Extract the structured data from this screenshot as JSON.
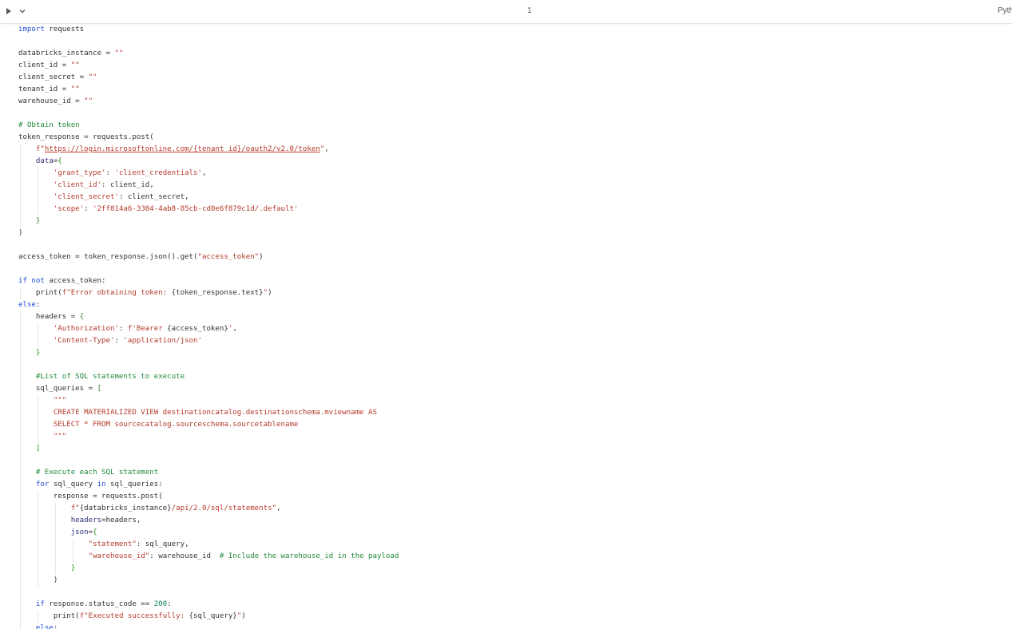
{
  "toolbar": {
    "run_icon": "play-icon",
    "collapse_icon": "chevron-down-icon",
    "cell_number": "1",
    "language": "Python"
  },
  "colors": {
    "keyword": "#1f4bd1",
    "string": "#b4392b",
    "comment": "#218a3a",
    "number": "#0f7d60",
    "kwarg": "#2b2f7a",
    "bracket": "#2f8a28",
    "text": "#333333"
  },
  "code_lines": [
    {
      "indent": 0,
      "tokens": [
        [
          "kw",
          "import"
        ],
        [
          "t",
          " requests"
        ]
      ]
    },
    {
      "indent": 0,
      "tokens": []
    },
    {
      "indent": 0,
      "tokens": [
        [
          "t",
          "databricks_instance = "
        ],
        [
          "s",
          "\"\""
        ]
      ]
    },
    {
      "indent": 0,
      "tokens": [
        [
          "t",
          "client_id = "
        ],
        [
          "s",
          "\"\""
        ]
      ]
    },
    {
      "indent": 0,
      "tokens": [
        [
          "t",
          "client_secret = "
        ],
        [
          "s",
          "\"\""
        ]
      ]
    },
    {
      "indent": 0,
      "tokens": [
        [
          "t",
          "tenant_id = "
        ],
        [
          "s",
          "\"\""
        ]
      ]
    },
    {
      "indent": 0,
      "tokens": [
        [
          "t",
          "warehouse_id = "
        ],
        [
          "s",
          "\"\""
        ]
      ]
    },
    {
      "indent": 0,
      "tokens": []
    },
    {
      "indent": 0,
      "tokens": [
        [
          "c",
          "# Obtain token"
        ]
      ]
    },
    {
      "indent": 0,
      "tokens": [
        [
          "t",
          "token_response = requests.post("
        ]
      ]
    },
    {
      "indent": 1,
      "tokens": [
        [
          "s",
          "f\""
        ],
        [
          "u",
          "https://login.microsoftonline.com/"
        ],
        [
          "ut",
          "{tenant_id}"
        ],
        [
          "u",
          "/oauth2/v2.0/token"
        ],
        [
          "s",
          "\""
        ],
        [
          "t",
          ","
        ]
      ]
    },
    {
      "indent": 1,
      "tokens": [
        [
          "k",
          "data"
        ],
        [
          "t",
          "="
        ],
        [
          "b",
          "{"
        ]
      ]
    },
    {
      "indent": 2,
      "tokens": [
        [
          "s",
          "'grant_type'"
        ],
        [
          "t",
          ": "
        ],
        [
          "s",
          "'client_credentials'"
        ],
        [
          "t",
          ","
        ]
      ]
    },
    {
      "indent": 2,
      "tokens": [
        [
          "s",
          "'client_id'"
        ],
        [
          "t",
          ": client_id,"
        ]
      ]
    },
    {
      "indent": 2,
      "tokens": [
        [
          "s",
          "'client_secret'"
        ],
        [
          "t",
          ": client_secret,"
        ]
      ]
    },
    {
      "indent": 2,
      "tokens": [
        [
          "s",
          "'scope'"
        ],
        [
          "t",
          ": "
        ],
        [
          "s",
          "'2ff814a6-3304-4ab8-85cb-cd0e6f879c1d/.default'"
        ]
      ]
    },
    {
      "indent": 1,
      "tokens": [
        [
          "b",
          "}"
        ]
      ]
    },
    {
      "indent": 0,
      "tokens": [
        [
          "t",
          ")"
        ]
      ]
    },
    {
      "indent": 0,
      "tokens": []
    },
    {
      "indent": 0,
      "tokens": [
        [
          "t",
          "access_token = token_response.json().get("
        ],
        [
          "s",
          "\"access_token\""
        ],
        [
          "t",
          ")"
        ]
      ]
    },
    {
      "indent": 0,
      "tokens": []
    },
    {
      "indent": 0,
      "tokens": [
        [
          "kw",
          "if not"
        ],
        [
          "t",
          " access_token:"
        ]
      ]
    },
    {
      "indent": 1,
      "tokens": [
        [
          "t",
          "print("
        ],
        [
          "s",
          "f\"Error obtaining token: "
        ],
        [
          "t",
          "{token_response.text}"
        ],
        [
          "s",
          "\""
        ],
        [
          "t",
          ")"
        ]
      ]
    },
    {
      "indent": 0,
      "tokens": [
        [
          "kw",
          "else"
        ],
        [
          "t",
          ":"
        ]
      ]
    },
    {
      "indent": 1,
      "tokens": [
        [
          "t",
          "headers = "
        ],
        [
          "b",
          "{"
        ]
      ]
    },
    {
      "indent": 2,
      "tokens": [
        [
          "s",
          "'Authorization'"
        ],
        [
          "t",
          ": "
        ],
        [
          "s",
          "f'Bearer "
        ],
        [
          "t",
          "{access_token}"
        ],
        [
          "s",
          "'"
        ],
        [
          "t",
          ","
        ]
      ]
    },
    {
      "indent": 2,
      "tokens": [
        [
          "s",
          "'Content-Type'"
        ],
        [
          "t",
          ": "
        ],
        [
          "s",
          "'application/json'"
        ]
      ]
    },
    {
      "indent": 1,
      "tokens": [
        [
          "b",
          "}"
        ]
      ]
    },
    {
      "indent": 0,
      "tokens": []
    },
    {
      "indent": 1,
      "tokens": [
        [
          "c",
          "#List of SQL statements to execute"
        ]
      ]
    },
    {
      "indent": 1,
      "tokens": [
        [
          "t",
          "sql_queries = "
        ],
        [
          "b",
          "["
        ]
      ]
    },
    {
      "indent": 2,
      "tokens": [
        [
          "s",
          "\"\"\""
        ]
      ]
    },
    {
      "indent": 2,
      "tokens": [
        [
          "s",
          "CREATE MATERIALIZED VIEW destinationcatalog.destinationschema.mviewname AS"
        ]
      ]
    },
    {
      "indent": 2,
      "tokens": [
        [
          "s",
          "SELECT * FROM sourcecatalog.sourceschema.sourcetablename"
        ]
      ]
    },
    {
      "indent": 2,
      "tokens": [
        [
          "s",
          "\"\"\""
        ]
      ]
    },
    {
      "indent": 1,
      "tokens": [
        [
          "b",
          "]"
        ]
      ]
    },
    {
      "indent": 0,
      "tokens": []
    },
    {
      "indent": 1,
      "tokens": [
        [
          "c",
          "# Execute each SQL statement"
        ]
      ]
    },
    {
      "indent": 1,
      "tokens": [
        [
          "kw",
          "for"
        ],
        [
          "t",
          " sql_query "
        ],
        [
          "kw",
          "in"
        ],
        [
          "t",
          " sql_queries:"
        ]
      ]
    },
    {
      "indent": 2,
      "tokens": [
        [
          "t",
          "response = requests.post("
        ]
      ]
    },
    {
      "indent": 3,
      "tokens": [
        [
          "s",
          "f\""
        ],
        [
          "t",
          "{databricks_instance}"
        ],
        [
          "s",
          "/api/2.0/sql/statements\""
        ],
        [
          "t",
          ","
        ]
      ]
    },
    {
      "indent": 3,
      "tokens": [
        [
          "k",
          "headers"
        ],
        [
          "t",
          "=headers,"
        ]
      ]
    },
    {
      "indent": 3,
      "tokens": [
        [
          "k",
          "json"
        ],
        [
          "t",
          "="
        ],
        [
          "b",
          "{"
        ]
      ]
    },
    {
      "indent": 4,
      "tokens": [
        [
          "s",
          "\"statement\""
        ],
        [
          "t",
          ": sql_query,"
        ]
      ]
    },
    {
      "indent": 4,
      "tokens": [
        [
          "s",
          "\"warehouse_id\""
        ],
        [
          "t",
          ": warehouse_id  "
        ],
        [
          "c",
          "# Include the warehouse_id in the payload"
        ]
      ]
    },
    {
      "indent": 3,
      "tokens": [
        [
          "b",
          "}"
        ]
      ]
    },
    {
      "indent": 2,
      "tokens": [
        [
          "t",
          ")"
        ]
      ]
    },
    {
      "indent": 0,
      "tokens": []
    },
    {
      "indent": 1,
      "tokens": [
        [
          "kw",
          "if"
        ],
        [
          "t",
          " response.status_code == "
        ],
        [
          "n",
          "200"
        ],
        [
          "t",
          ":"
        ]
      ]
    },
    {
      "indent": 2,
      "tokens": [
        [
          "t",
          "print("
        ],
        [
          "s",
          "f\"Executed successfully: "
        ],
        [
          "t",
          "{sql_query}"
        ],
        [
          "s",
          "\""
        ],
        [
          "t",
          ")"
        ]
      ]
    },
    {
      "indent": 1,
      "tokens": [
        [
          "kw",
          "else"
        ],
        [
          "t",
          ":"
        ]
      ]
    }
  ]
}
